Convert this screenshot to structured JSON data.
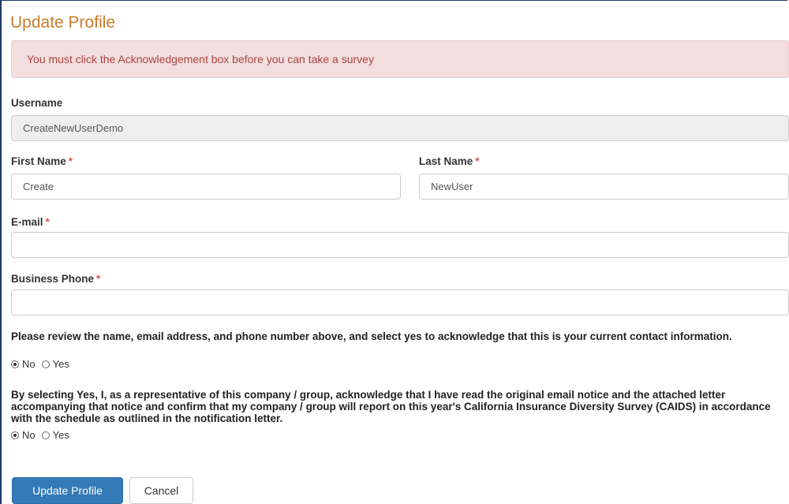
{
  "page": {
    "title": "Update Profile",
    "alert": "You must click the Acknowledgement box before you can take a survey"
  },
  "fields": {
    "username": {
      "label": "Username",
      "value": "CreateNewUserDemo"
    },
    "first_name": {
      "label": "First Name",
      "value": "Create",
      "required_mark": "*"
    },
    "last_name": {
      "label": "Last Name",
      "value": "NewUser",
      "required_mark": "*"
    },
    "email": {
      "label": "E-mail",
      "value": "",
      "required_mark": "*"
    },
    "business_phone": {
      "label": "Business Phone",
      "value": "",
      "required_mark": "*"
    }
  },
  "ack_contact": {
    "text": "Please review the name, email address, and phone number above, and select yes to acknowledge that this is your current contact information.",
    "options": [
      "No",
      "Yes"
    ],
    "selected": "No"
  },
  "ack_survey": {
    "text": "By selecting Yes, I, as a representative of this company / group, acknowledge that I have read the original email notice and the attached letter accompanying that notice and confirm that my company / group will report on this year's California Insurance Diversity Survey (CAIDS) in accordance with the schedule as outlined in the notification letter.",
    "options": [
      "No",
      "Yes"
    ],
    "selected": "No"
  },
  "actions": {
    "submit_label": "Update Profile",
    "cancel_label": "Cancel"
  },
  "colors": {
    "title": "#c87c2a",
    "alert_bg": "#f2dede",
    "alert_text": "#a94442",
    "primary": "#337ab7",
    "required": "#d9534f"
  }
}
